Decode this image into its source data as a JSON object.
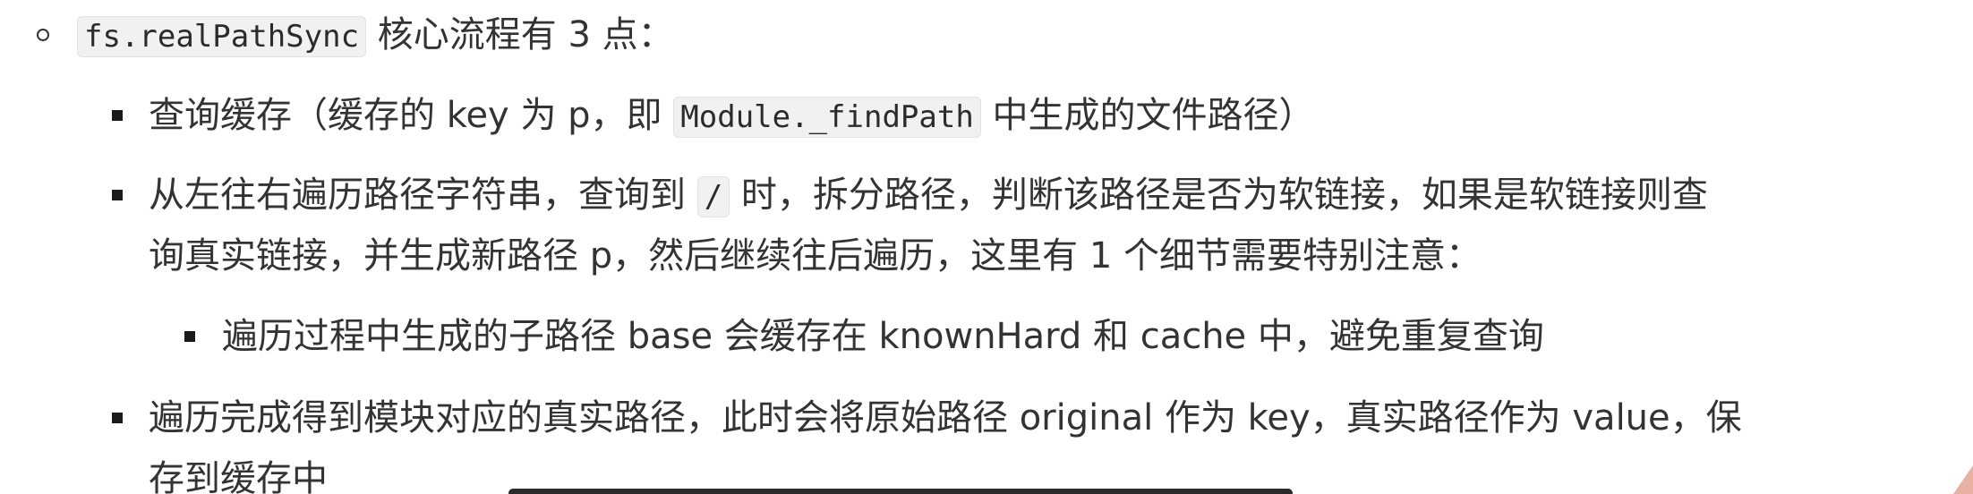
{
  "level1": {
    "code": "fs.realPathSync",
    "text": " 核心流程有 3 点："
  },
  "items": {
    "cache_lookup": {
      "text_before": "查询缓存（缓存的 key 为 p，即 ",
      "code": "Module._findPath",
      "text_after": " 中生成的文件路径）"
    },
    "traverse": {
      "line1_before": "从左往右遍历路径字符串，查询到 ",
      "code": "/",
      "line1_after": " 时，拆分路径，判断该路径是否为软链接，如果是软链接则查",
      "line2": "询真实链接，并生成新路径 p，然后继续往后遍历，这里有 1 个细节需要特别注意："
    },
    "sub_note": {
      "text": "遍历过程中生成的子路径 base 会缓存在 knownHard 和 cache 中，避免重复查询"
    },
    "finish": {
      "line1": "遍历完成得到模块对应的真实路径，此时会将原始路径 original 作为 key，真实路径作为 value，保",
      "line2": "存到缓存中"
    }
  }
}
